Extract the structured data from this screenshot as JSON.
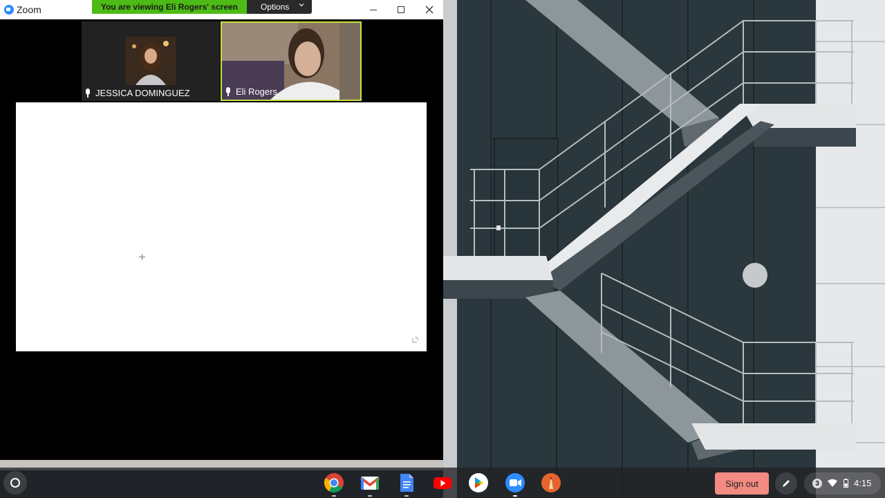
{
  "window": {
    "title": "Zoom",
    "share_banner": "You are viewing Eli Rogers' screen",
    "options_label": "Options"
  },
  "participants": [
    {
      "name": "JESSICA DOMINGUEZ",
      "active_speaker": false
    },
    {
      "name": "Eli Rogers",
      "active_speaker": true
    }
  ],
  "shelf": {
    "apps": [
      "chrome-icon",
      "gmail-icon",
      "google-docs-icon",
      "youtube-icon",
      "play-store-icon",
      "zoom-icon",
      "pencil-app-icon"
    ],
    "sign_out_label": "Sign out",
    "notification_count": "3",
    "time": "4:15"
  },
  "colors": {
    "banner_green": "#4dbb16",
    "active_speaker_border": "#c8e23c",
    "sign_out_bg": "#f28b82",
    "zoom_blue": "#2d8cff"
  }
}
